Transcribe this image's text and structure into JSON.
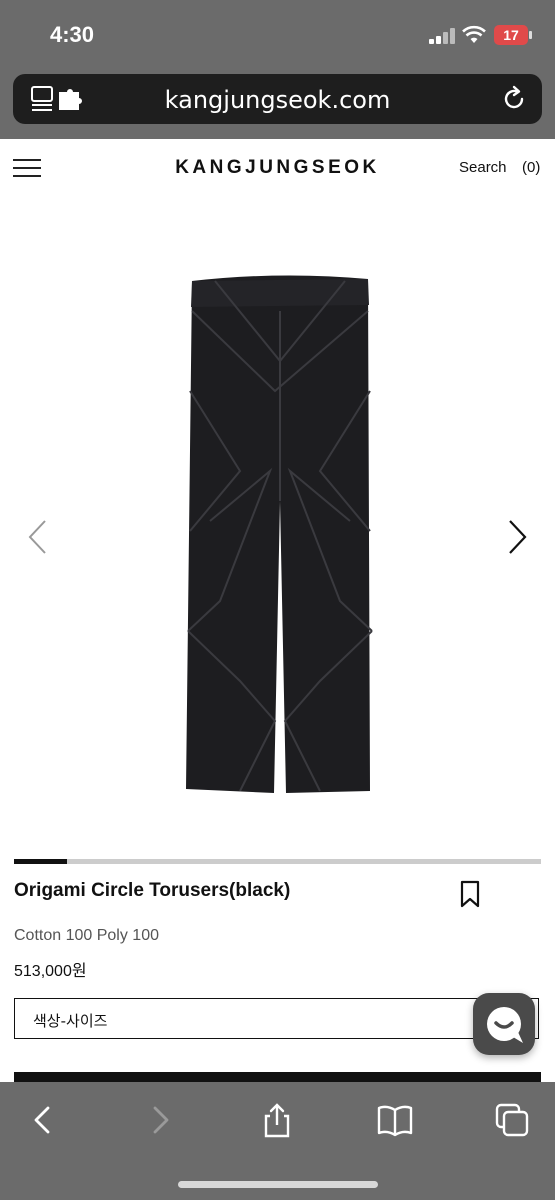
{
  "status_bar": {
    "time": "4:30",
    "battery": "17"
  },
  "browser": {
    "url": "kangjungseok.com"
  },
  "site": {
    "logo": "KANGJUNGSEOK",
    "search_label": "Search",
    "cart_label": "(0)"
  },
  "gallery": {
    "progress_fraction": 0.1,
    "active_index": 1
  },
  "product": {
    "name": "Origami Circle Torusers(black)",
    "material": "Cotton 100 Poly 100",
    "price": "513,000원",
    "option_label": "색상-사이즈"
  },
  "icons": {
    "menu": "hamburger-menu-icon",
    "prev": "chevron-left-icon",
    "next": "chevron-right-icon",
    "bookmark": "bookmark-icon",
    "chat": "chat-bubble-icon",
    "reload": "reload-icon",
    "tabs": "tab-overview-icon"
  },
  "colors": {
    "chrome": "#6b6b6b",
    "urlbar": "#1e1e1e",
    "battery": "#e04a4a",
    "accent": "#111111"
  }
}
